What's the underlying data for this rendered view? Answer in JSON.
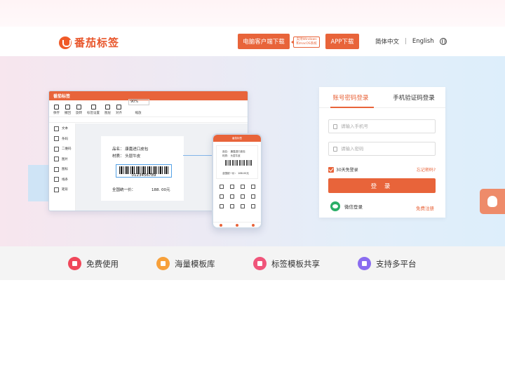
{
  "header": {
    "brand": "番茄标签",
    "pc_download": "电脑客户端下载",
    "sys_tag_line1": "支持Windows",
    "sys_tag_line2": "和macOS系统",
    "app_download": "APP下载",
    "lang_zh": "简体中文",
    "lang_sep": "|",
    "lang_en": "English"
  },
  "editor": {
    "title": "番茄标签",
    "toolbar": [
      "保存",
      "撤回",
      "旋转",
      "标签设置",
      "图层",
      "对齐",
      "缩放"
    ],
    "zoom": "90%",
    "side": [
      "文本",
      "条码",
      "二维码",
      "图片",
      "图标",
      "线条",
      "矩形"
    ],
    "label_line1": "品名：  康嘉进口皮包",
    "label_line2": "材质：  头层牛皮",
    "barcode_number": "0123456789",
    "price_label": "全国统一价：",
    "price_value": "188. 00元"
  },
  "phone": {
    "title": "番茄标签",
    "line1": "品名： 康嘉进口皮包",
    "line2": "材质： 头层牛皮",
    "line3": "全国统一价：     188.00元"
  },
  "login": {
    "tab_account": "账号密码登录",
    "tab_sms": "手机验证码登录",
    "phone_placeholder": "请输入手机号",
    "password_placeholder": "请输入密码",
    "remember": "30天免登录",
    "forgot": "忘记密码?",
    "submit": "登 录",
    "wechat": "微信登录",
    "register": "免费注册"
  },
  "features": [
    {
      "label": "免费使用",
      "color": "#f0475a"
    },
    {
      "label": "海量模板库",
      "color": "#f7a03a"
    },
    {
      "label": "标签模板共享",
      "color": "#f0557a"
    },
    {
      "label": "支持多平台",
      "color": "#8a6cf0"
    }
  ],
  "colors": {
    "accent": "#e8643a"
  }
}
